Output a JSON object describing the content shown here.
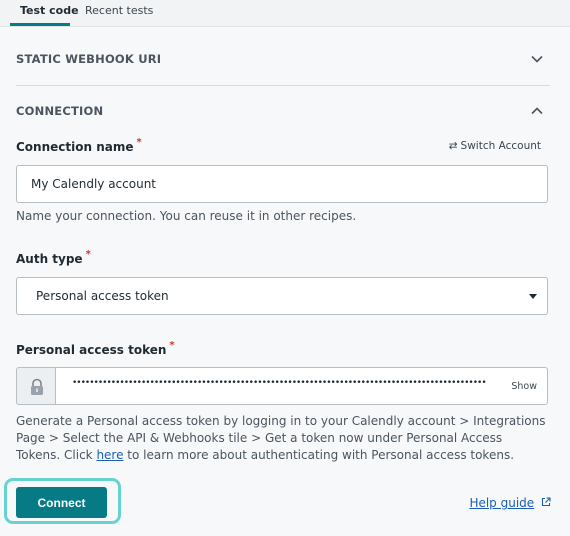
{
  "tabs": [
    {
      "label": "Test code",
      "active": true
    },
    {
      "label": "Recent tests",
      "active": false
    }
  ],
  "sections": {
    "webhook": {
      "title": "STATIC WEBHOOK URI",
      "expanded": false
    },
    "connection": {
      "title": "CONNECTION",
      "expanded": true
    }
  },
  "connection_name": {
    "label": "Connection name",
    "required_marker": "*",
    "value": "My Calendly account",
    "hint": "Name your connection. You can reuse it in other recipes.",
    "switch_account": "Switch Account",
    "switch_icon": "switch-arrows-icon"
  },
  "auth_type": {
    "label": "Auth type",
    "required_marker": "*",
    "selected": "Personal access token"
  },
  "token": {
    "label": "Personal access token",
    "required_marker": "*",
    "masked_value": "••••••••••••••••••••••••••••••••••••••••••••••••••••••••••••••••••••••••••••••••••••••••••••••••",
    "show_label": "Show",
    "help_before": "Generate a Personal access token by logging in to your Calendly account > Integrations Page > Select the API & Webhooks tile > Get a token now under Personal Access Tokens. Click ",
    "help_link": "here",
    "help_after": " to learn more about authenticating with Personal access tokens."
  },
  "footer": {
    "connect_label": "Connect",
    "help_guide_label": "Help guide"
  },
  "colors": {
    "accent": "#067a85",
    "focus_ring": "#66d3d0",
    "link": "#1a5fb4",
    "required": "#d0342c"
  }
}
